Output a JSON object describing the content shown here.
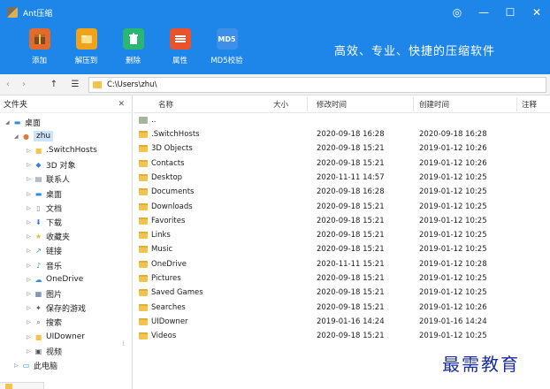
{
  "app": {
    "title": "Ant压缩",
    "slogan": "高效、专业、快捷的压缩软件"
  },
  "window_controls": {
    "settings": "◎",
    "minimize": "—",
    "maximize": "☐",
    "close": "✕"
  },
  "toolbar": {
    "items": [
      {
        "label": "添加",
        "icon": "archive-add-icon",
        "color": "#e26a2c"
      },
      {
        "label": "解压到",
        "icon": "extract-folder-icon",
        "color": "#f0a21b"
      },
      {
        "label": "删除",
        "icon": "delete-icon",
        "color": "#2bb673"
      },
      {
        "label": "属性",
        "icon": "properties-icon",
        "color": "#e8532b"
      },
      {
        "label": "MD5校验",
        "icon": "md5-icon",
        "color": "#3d8fe8",
        "text": "MD5"
      }
    ]
  },
  "address": {
    "path": "C:\\Users\\zhu\\"
  },
  "left_panel": {
    "header": "文件夹",
    "close": "✕",
    "tree": [
      {
        "label": "桌面",
        "level": 0,
        "icon": "desktop-icon",
        "expanded": true
      },
      {
        "label": "zhu",
        "level": 1,
        "icon": "user-icon",
        "expanded": true,
        "selected": true
      },
      {
        "label": ".SwitchHosts",
        "level": 2,
        "icon": "folder-icon"
      },
      {
        "label": "3D 对象",
        "level": 2,
        "icon": "3d-objects-icon"
      },
      {
        "label": "联系人",
        "level": 2,
        "icon": "contacts-icon"
      },
      {
        "label": "桌面",
        "level": 2,
        "icon": "desktop-icon"
      },
      {
        "label": "文档",
        "level": 2,
        "icon": "document-icon"
      },
      {
        "label": "下载",
        "level": 2,
        "icon": "download-icon"
      },
      {
        "label": "收藏夹",
        "level": 2,
        "icon": "favorites-icon"
      },
      {
        "label": "链接",
        "level": 2,
        "icon": "link-icon"
      },
      {
        "label": "音乐",
        "level": 2,
        "icon": "music-icon"
      },
      {
        "label": "OneDrive",
        "level": 2,
        "icon": "cloud-icon"
      },
      {
        "label": "图片",
        "level": 2,
        "icon": "pictures-icon"
      },
      {
        "label": "保存的游戏",
        "level": 2,
        "icon": "games-icon"
      },
      {
        "label": "搜索",
        "level": 2,
        "icon": "search-icon"
      },
      {
        "label": "UIDowner",
        "level": 2,
        "icon": "folder-icon"
      },
      {
        "label": "视频",
        "level": 2,
        "icon": "video-icon"
      },
      {
        "label": "此电脑",
        "level": 1,
        "icon": "computer-icon"
      }
    ]
  },
  "file_list": {
    "columns": {
      "name": "名称",
      "size": "大小",
      "modified": "修改时间",
      "created": "创建时间",
      "comment": "注释"
    },
    "parent": "..",
    "rows": [
      {
        "name": ".SwitchHosts",
        "modified": "2020-09-18 16:28",
        "created": "2020-09-18 16:28"
      },
      {
        "name": "3D Objects",
        "modified": "2020-09-18 15:21",
        "created": "2019-01-12 10:26"
      },
      {
        "name": "Contacts",
        "modified": "2020-09-18 15:21",
        "created": "2019-01-12 10:26"
      },
      {
        "name": "Desktop",
        "modified": "2020-11-11 14:57",
        "created": "2019-01-12 10:25"
      },
      {
        "name": "Documents",
        "modified": "2020-09-18 16:28",
        "created": "2019-01-12 10:25"
      },
      {
        "name": "Downloads",
        "modified": "2020-09-18 15:21",
        "created": "2019-01-12 10:25"
      },
      {
        "name": "Favorites",
        "modified": "2020-09-18 15:21",
        "created": "2019-01-12 10:25"
      },
      {
        "name": "Links",
        "modified": "2020-09-18 15:21",
        "created": "2019-01-12 10:25"
      },
      {
        "name": "Music",
        "modified": "2020-09-18 15:21",
        "created": "2019-01-12 10:25"
      },
      {
        "name": "OneDrive",
        "modified": "2020-11-11 15:21",
        "created": "2019-01-12 10:28"
      },
      {
        "name": "Pictures",
        "modified": "2020-09-18 15:21",
        "created": "2019-01-12 10:25"
      },
      {
        "name": "Saved Games",
        "modified": "2020-09-18 15:21",
        "created": "2019-01-12 10:25"
      },
      {
        "name": "Searches",
        "modified": "2020-09-18 15:21",
        "created": "2019-01-12 10:26"
      },
      {
        "name": "UIDowner",
        "modified": "2019-01-16 14:24",
        "created": "2019-01-16 14:24"
      },
      {
        "name": "Videos",
        "modified": "2020-09-18 15:21",
        "created": "2019-01-12 10:25"
      }
    ]
  },
  "watermark": "最需教育"
}
